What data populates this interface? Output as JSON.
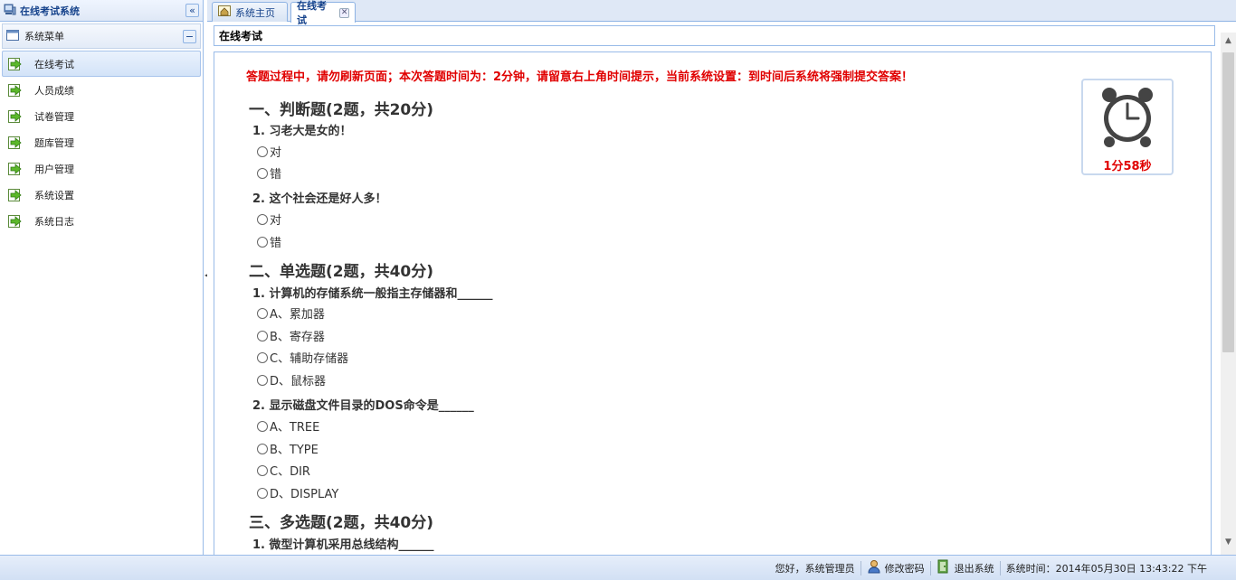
{
  "app": {
    "title": "在线考试系统",
    "collapse_icon": "double-chevron-left-icon"
  },
  "sidebar": {
    "menu_title": "系统菜单",
    "items": [
      {
        "label": "在线考试",
        "active": true
      },
      {
        "label": "人员成绩"
      },
      {
        "label": "试卷管理"
      },
      {
        "label": "题库管理"
      },
      {
        "label": "用户管理"
      },
      {
        "label": "系统设置"
      },
      {
        "label": "系统日志"
      }
    ]
  },
  "tabs": [
    {
      "label": "系统主页"
    },
    {
      "label": "在线考试",
      "active": true,
      "closable": true
    }
  ],
  "panel": {
    "title": "在线考试"
  },
  "exam": {
    "notice": "答题过程中，请勿刷新页面；本次答题时间为：2分钟，请留意右上角时间提示，当前系统设置：到时间后系统将强制提交答案！",
    "sections": [
      {
        "title": "一、判断题(2题，共20分)",
        "questions": [
          {
            "text": "1. 习老大是女的！",
            "options": [
              "对",
              "错"
            ]
          },
          {
            "text": "2. 这个社会还是好人多！",
            "options": [
              "对",
              "错"
            ]
          }
        ]
      },
      {
        "title": "二、单选题(2题，共40分)",
        "questions": [
          {
            "text": "1. 计算机的存储系统一般指主存储器和______",
            "options": [
              "A、累加器",
              "B、寄存器",
              "C、辅助存储器",
              "D、鼠标器"
            ]
          },
          {
            "text": "2. 显示磁盘文件目录的DOS命令是______",
            "options": [
              "A、TREE",
              "B、TYPE",
              "C、DIR",
              "D、DISPLAY"
            ]
          }
        ]
      },
      {
        "title": "三、多选题(2题，共40分)",
        "questions": [
          {
            "text": "1. 微型计算机采用总线结构______",
            "options": []
          }
        ]
      }
    ],
    "timer": {
      "remaining": "1分58秒",
      "icon": "alarm-clock-icon",
      "color": "#e00000"
    }
  },
  "statusbar": {
    "greeting": "您好，系统管理员",
    "change_password": "修改密码",
    "logout": "退出系统",
    "time_label": "系统时间：",
    "time_value": "2014年05月30日 13:43:22 下午"
  },
  "colors": {
    "accent": "#99bbe8",
    "header_text": "#15428b",
    "alert": "#e00000"
  }
}
